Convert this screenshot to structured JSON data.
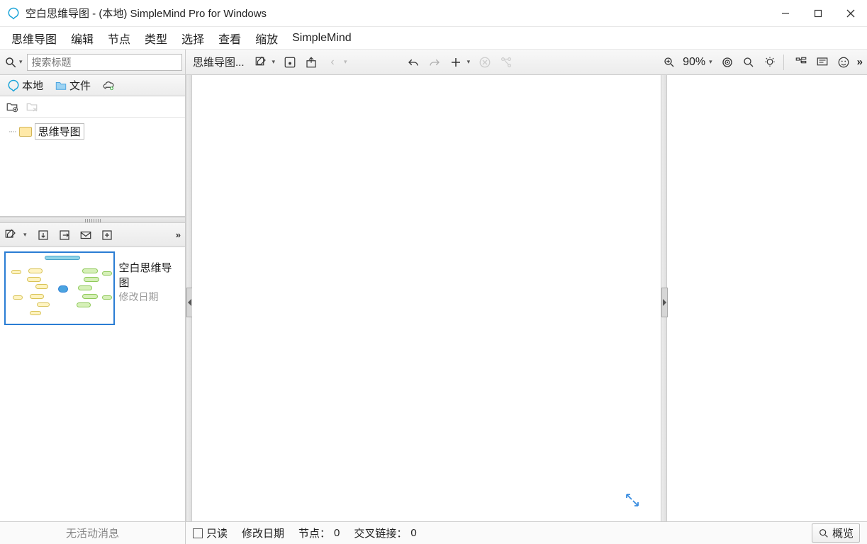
{
  "window": {
    "title": "空白思维导图 - (本地) SimpleMind Pro for Windows"
  },
  "menu": {
    "items": [
      "思维导图",
      "编辑",
      "节点",
      "类型",
      "选择",
      "查看",
      "缩放",
      "SimpleMind"
    ]
  },
  "toolbar": {
    "search_placeholder": "搜索标题",
    "mindmap_label": "思维导图...",
    "zoom_label": "90%"
  },
  "sidebar": {
    "tabs": {
      "local": "本地",
      "files": "文件"
    },
    "tree": {
      "root": "思维导图"
    },
    "thumb": {
      "title": "空白思维导图",
      "subtitle": "修改日期"
    }
  },
  "status": {
    "no_activity": "无活动消息",
    "readonly": "只读",
    "mod_date": "修改日期",
    "nodes_label": "节点：",
    "nodes_count": "0",
    "crosslinks_label": "交叉链接：",
    "crosslinks_count": "0",
    "overview": "概览"
  }
}
